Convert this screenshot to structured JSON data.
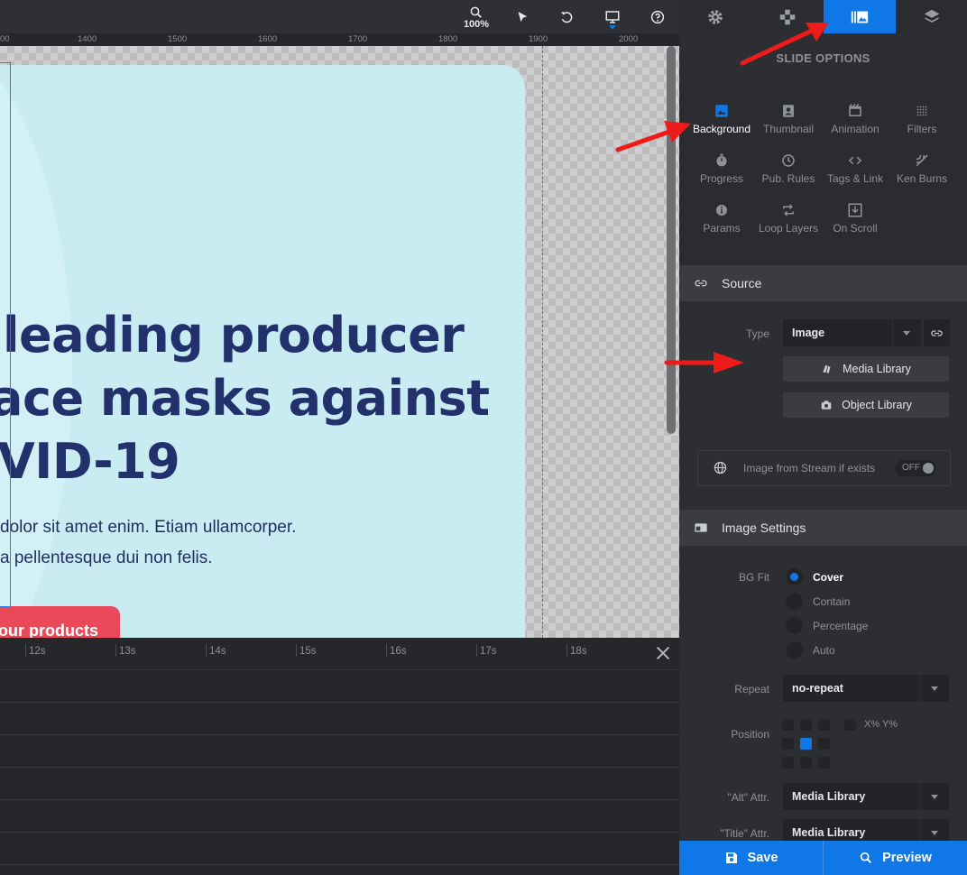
{
  "toolbar": {
    "zoom": "100%",
    "tools": [
      "zoom-tool",
      "select-tool",
      "undo",
      "device-desktop",
      "help"
    ]
  },
  "ruler": {
    "ticks": [
      "00",
      "1400",
      "1500",
      "1600",
      "1700",
      "1800",
      "1900",
      "2000"
    ]
  },
  "slide": {
    "headline": [
      "leading producer",
      "ace masks against",
      "VID-19"
    ],
    "body": [
      "dolor sit amet enim. Etiam ullamcorper.",
      "a pellentesque dui non felis."
    ],
    "cta_label": "our products",
    "colors": {
      "bg": "#c9ecf3",
      "headline": "#22306b",
      "cta": "#e94959"
    }
  },
  "timeline": {
    "ticks": [
      "12s",
      "13s",
      "14s",
      "15s",
      "16s",
      "17s",
      "18s"
    ]
  },
  "panel": {
    "tabs": [
      {
        "name": "settings",
        "icon": "gear-icon"
      },
      {
        "name": "navigation",
        "icon": "gamepad-icon"
      },
      {
        "name": "slide-options",
        "icon": "slides-icon",
        "active": true
      },
      {
        "name": "layers",
        "icon": "layers-icon"
      }
    ],
    "title": "SLIDE OPTIONS",
    "options": [
      {
        "label": "Background",
        "icon": "image-icon",
        "active": true
      },
      {
        "label": "Thumbnail",
        "icon": "portrait-icon"
      },
      {
        "label": "Animation",
        "icon": "film-icon"
      },
      {
        "label": "Filters",
        "icon": "dots-grid-icon"
      },
      {
        "label": "Progress",
        "icon": "stopwatch-icon"
      },
      {
        "label": "Pub. Rules",
        "icon": "clock-icon"
      },
      {
        "label": "Tags & Link",
        "icon": "code-icon"
      },
      {
        "label": "Ken Burns",
        "icon": "kenburns-icon"
      },
      {
        "label": "Params",
        "icon": "info-icon"
      },
      {
        "label": "Loop Layers",
        "icon": "loop-icon"
      },
      {
        "label": "On Scroll",
        "icon": "scroll-download-icon"
      }
    ],
    "source": {
      "header": "Source",
      "type_label": "Type",
      "type_value": "Image",
      "media_library": "Media Library",
      "object_library": "Object Library",
      "stream_label": "Image from Stream if exists",
      "stream_toggle": "OFF"
    },
    "image_settings": {
      "header": "Image Settings",
      "bg_fit_label": "BG Fit",
      "bg_fit_options": [
        "Cover",
        "Contain",
        "Percentage",
        "Auto"
      ],
      "bg_fit_selected": "Cover",
      "repeat_label": "Repeat",
      "repeat_value": "no-repeat",
      "position_label": "Position",
      "position_selected": "center-center",
      "xy_label": "X% Y%",
      "alt_label": "\"Alt\" Attr.",
      "alt_value": "Media Library",
      "title_label": "\"Title\" Attr.",
      "title_value": "Media Library"
    },
    "footer": {
      "save": "Save",
      "preview": "Preview"
    },
    "accent": "#0f77e6"
  }
}
